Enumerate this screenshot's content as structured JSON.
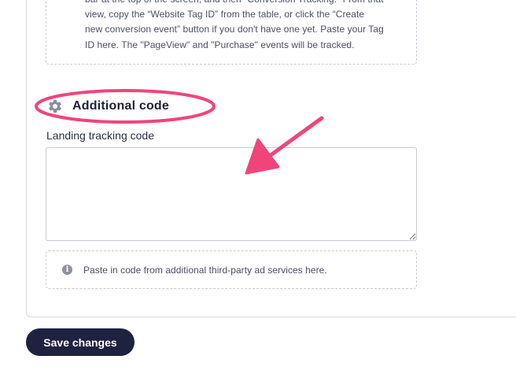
{
  "instructions_box": {
    "lines": [
      "bar at the top of the screen, and then \"Conversion Tracking.\" From that",
      "view, copy the “Website Tag ID” from the table, or click the “Create",
      "new conversion event” button if you don't have one yet. Paste your Tag",
      "ID here. The \"PageView\" and \"Purchase\" events will be tracked."
    ]
  },
  "additional_code": {
    "title": "Additional code",
    "icon": "gear-icon",
    "field_label": "Landing tracking code",
    "textarea_value": "",
    "hint_icon": "info-icon",
    "hint_text": "Paste in code from additional third-party ad services here."
  },
  "actions": {
    "save_label": "Save changes"
  },
  "colors": {
    "accent": "#1f2140",
    "annotation": "#f0457a"
  }
}
